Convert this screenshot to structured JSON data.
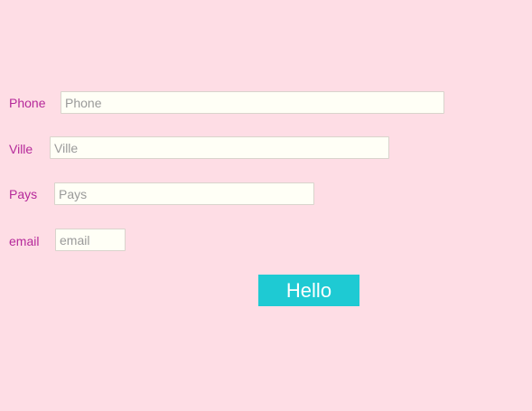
{
  "form": {
    "phone": {
      "label": "Phone",
      "placeholder": "Phone",
      "value": ""
    },
    "ville": {
      "label": "Ville",
      "placeholder": "Ville",
      "value": ""
    },
    "pays": {
      "label": "Pays",
      "placeholder": "Pays",
      "value": ""
    },
    "email": {
      "label": "email",
      "placeholder": "email",
      "value": ""
    },
    "submit_label": "Hello"
  },
  "colors": {
    "background": "#fedde5",
    "label": "#b5299a",
    "input_background": "#fffff6",
    "button": "#1ecad3",
    "button_text": "#ffffff"
  }
}
